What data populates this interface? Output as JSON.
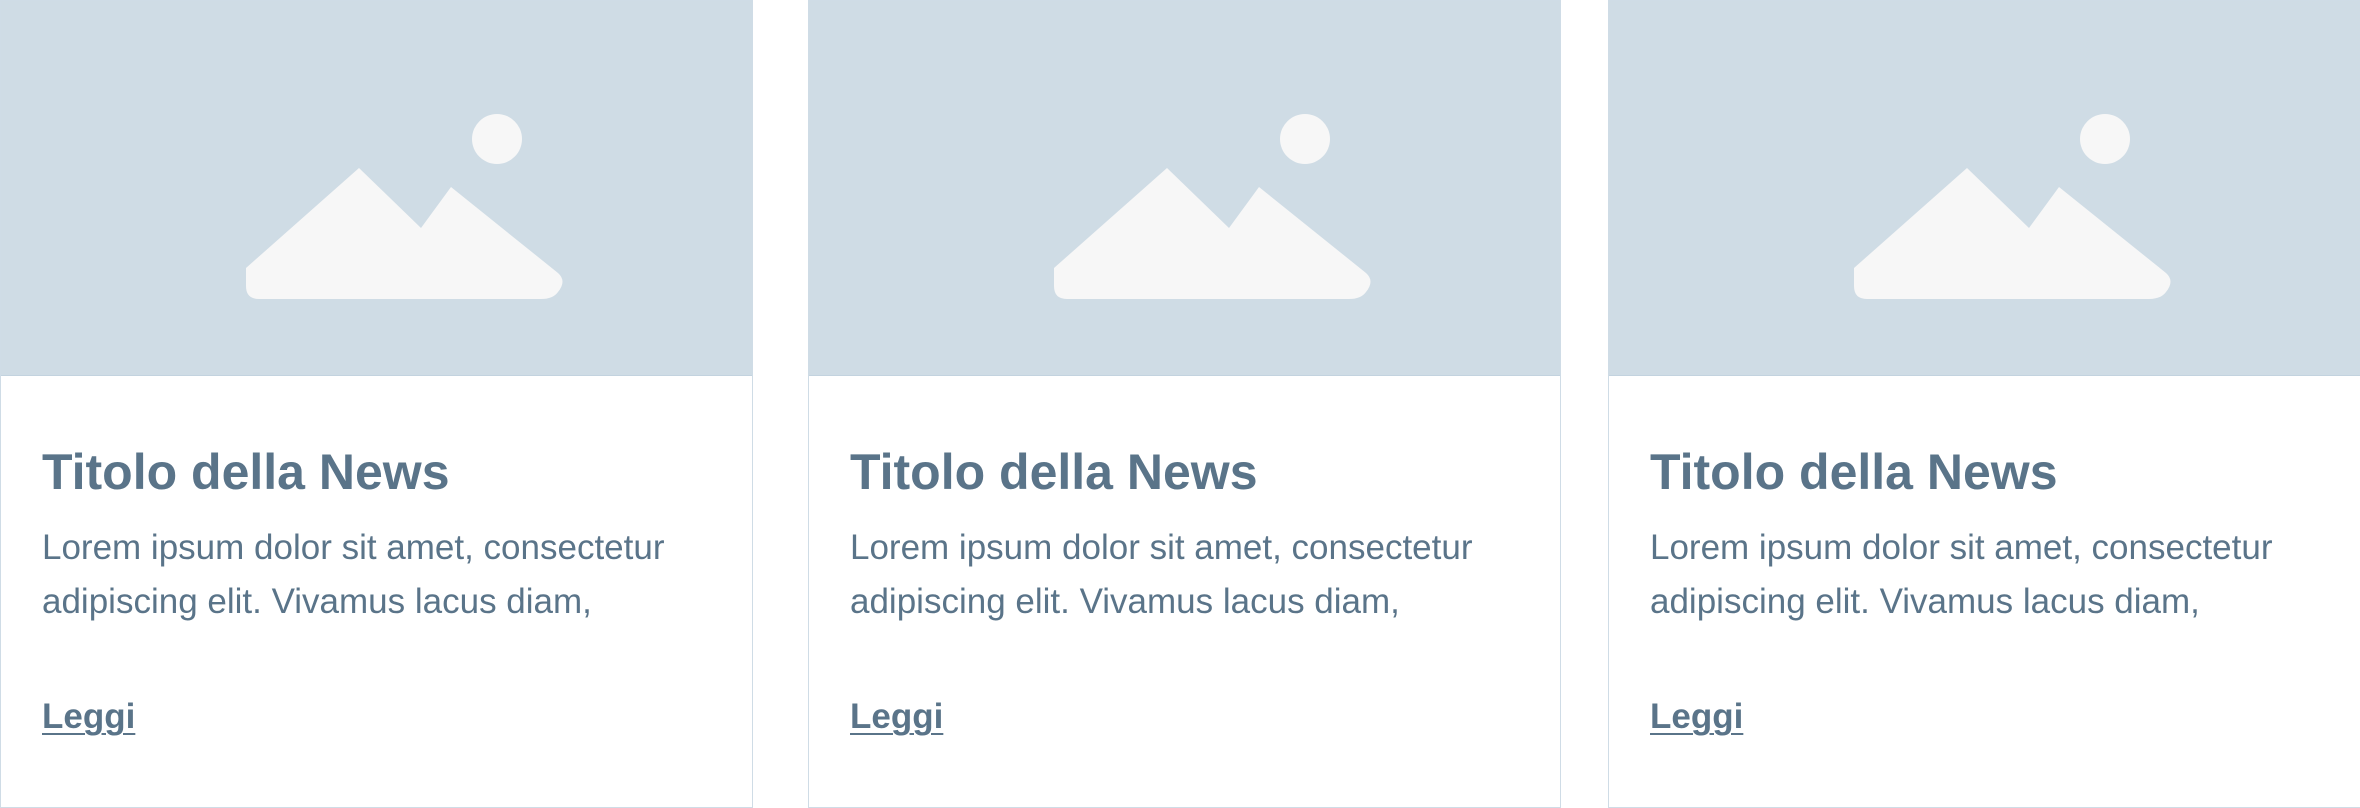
{
  "cards": [
    {
      "image_icon": "image-placeholder-icon",
      "title": "Titolo della News",
      "text": "Lorem ipsum dolor sit amet, consectetur adipiscing elit. Vivamus lacus diam,",
      "link_label": "Leggi"
    },
    {
      "image_icon": "image-placeholder-icon",
      "title": "Titolo della News",
      "text": "Lorem ipsum dolor sit amet, consectetur adipiscing elit. Vivamus lacus diam,",
      "link_label": "Leggi"
    },
    {
      "image_icon": "image-placeholder-icon",
      "title": "Titolo della News",
      "text": "Lorem ipsum dolor sit amet, consectetur adipiscing elit. Vivamus lacus diam,",
      "link_label": "Leggi"
    }
  ],
  "colors": {
    "image_background": "#cfdce5",
    "placeholder_shape": "#f7f7f7",
    "text": "#5a7489",
    "border": "#cfdce6"
  }
}
